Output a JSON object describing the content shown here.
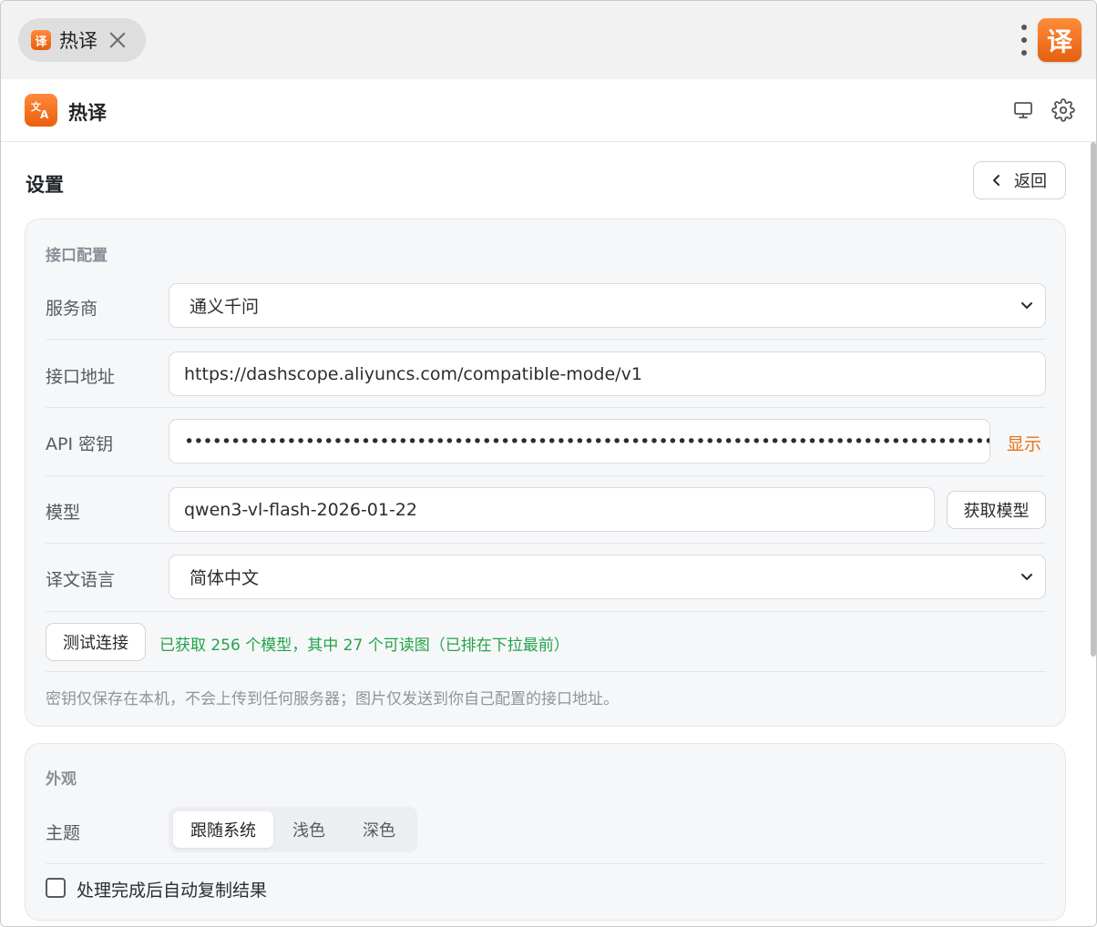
{
  "window": {
    "tab_title": "热译",
    "tab_icon": "译",
    "app_badge": "译"
  },
  "header": {
    "logo_icon": "translate-icon",
    "app_name": "热译"
  },
  "page": {
    "title": "设置",
    "back_label": "返回"
  },
  "api_config": {
    "section_title": "接口配置",
    "provider": {
      "label": "服务商",
      "value": "通义千问"
    },
    "endpoint": {
      "label": "接口地址",
      "value": "https://dashscope.aliyuncs.com/compatible-mode/v1"
    },
    "api_key": {
      "label": "API 密钥",
      "value": "••••••••••••••••••••••••••••••••••••••••••••••••••••••••••••••••••••••••••••••••••••••••••••••••••••",
      "toggle_label": "显示"
    },
    "model": {
      "label": "模型",
      "value": "qwen3-vl-flash-2026-01-22",
      "fetch_label": "获取模型"
    },
    "target_lang": {
      "label": "译文语言",
      "value": "简体中文"
    },
    "test_label": "测试连接",
    "status": "已获取 256 个模型，其中 27 个可读图（已排在下拉最前）",
    "privacy_note": "密钥仅保存在本机，不会上传到任何服务器；图片仅发送到你自己配置的接口地址。"
  },
  "appearance": {
    "section_title": "外观",
    "theme_label": "主题",
    "theme_options": [
      "跟随系统",
      "浅色",
      "深色"
    ],
    "theme_selected": "跟随系统",
    "auto_copy_label": "处理完成后自动复制结果",
    "auto_copy_checked": false
  },
  "colors": {
    "accent": "#e8710f",
    "success": "#23a34a"
  }
}
